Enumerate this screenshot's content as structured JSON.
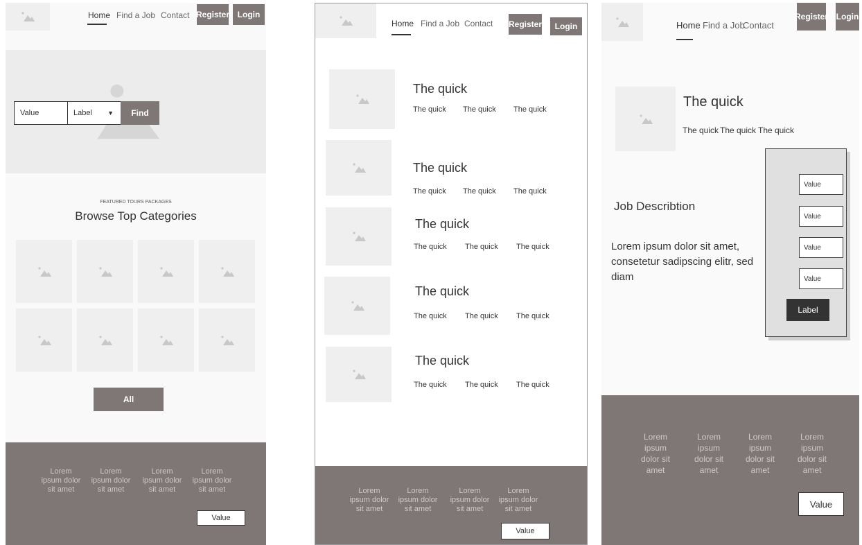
{
  "nav": {
    "home": "Home",
    "find_job": "Find a Job",
    "contact": "Contact",
    "register": "Register",
    "login": "Login"
  },
  "screen1": {
    "search": {
      "value": "Value",
      "select_value": "Label",
      "find": "Find"
    },
    "section": {
      "eyebrow": "FEATURED TOURS PACKAGES",
      "title": "Browse Top Categories"
    },
    "all_button": "All"
  },
  "screen2": {
    "items": [
      {
        "title": "The quick",
        "subs": [
          "The quick",
          "The quick",
          "The quick"
        ]
      },
      {
        "title": "The quick",
        "subs": [
          "The quick",
          "The quick",
          "The quick"
        ]
      },
      {
        "title": "The quick",
        "subs": [
          "The quick",
          "The quick",
          "The quick"
        ]
      },
      {
        "title": "The quick",
        "subs": [
          "The quick",
          "The quick",
          "The quick"
        ]
      },
      {
        "title": "The quick",
        "subs": [
          "The quick",
          "The quick",
          "The quick"
        ]
      }
    ]
  },
  "screen3": {
    "header": {
      "title": "The quick",
      "subs": [
        "The quick",
        "The quick",
        "The quick"
      ]
    },
    "job_title": "Job Describtion",
    "job_text": "Lorem ipsum dolor sit amet, consetetur sadipscing elitr, sed diam",
    "form": {
      "fields": [
        "Value",
        "Value",
        "Value",
        "Value"
      ],
      "button": "Label"
    }
  },
  "footer": {
    "columns": [
      "Lorem ipsum dolor sit amet",
      "Lorem ipsum dolor sit amet",
      "Lorem ipsum dolor sit amet",
      "Lorem ipsum dolor sit amet"
    ],
    "input_value": "Value"
  },
  "colors": {
    "brand": "#7f7676",
    "dark": "#333333",
    "placeholder": "#efefef"
  },
  "icons": {
    "placeholder": "image-placeholder-icon",
    "chevron": "chevron-down-icon"
  }
}
